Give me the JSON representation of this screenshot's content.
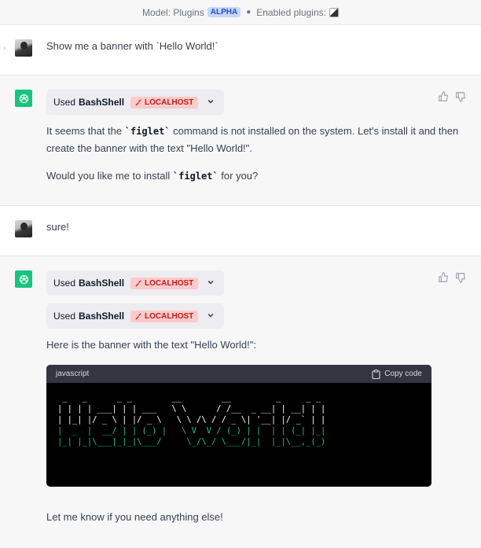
{
  "header": {
    "model_label": "Model: Plugins",
    "model_badge": "ALPHA",
    "plugins_label": "Enabled plugins:"
  },
  "messages": [
    {
      "role": "user",
      "text_pre": "Show me a banner with ",
      "text_code": "`Hello World!`"
    },
    {
      "role": "assistant",
      "plugin": {
        "used": "Used",
        "name": "BashShell",
        "badge": "LOCALHOST"
      },
      "para1_a": "It seems that the ",
      "para1_code": "`figlet`",
      "para1_b": " command is not installed on the system. Let's install it and then",
      "para1_c": "create the banner with the text \"Hello World!\".",
      "para2_a": "Would you like me to install ",
      "para2_code": "`figlet`",
      "para2_b": " for you?"
    },
    {
      "role": "user",
      "text": "sure!"
    },
    {
      "role": "assistant",
      "plugins": [
        {
          "used": "Used",
          "name": "BashShell",
          "badge": "LOCALHOST"
        },
        {
          "used": "Used",
          "name": "BashShell",
          "badge": "LOCALHOST"
        }
      ],
      "intro": "Here is the banner with the text \"Hello World!\":",
      "code_lang": "javascript",
      "copy_label": "Copy code",
      "code_lines": [
        " _   _      _ _        __        __         _     _ _ ",
        "| | | | ___| | | ___   \\ \\      / /__  _ __| | __| | |",
        "| |_| |/ _ \\ | |/ _ \\   \\ \\ /\\ / / _ \\| '__| |/ _` | |",
        "|  _  |  __/ | | (_) |   \\ V  V / (_) | |  | | (_| |_|",
        "|_| |_|\\___|_|_|\\___/     \\_/\\_/ \\___/|_|  |_|\\__,_(_)"
      ],
      "outro": "Let me know if you need anything else!"
    }
  ],
  "colors": {
    "bot_avatar": "#19c37d",
    "badge_bg": "#fecaca",
    "badge_text": "#b91c1c",
    "alpha_bg": "#c7d7fe"
  },
  "icons": [
    "openai-logo-icon",
    "wrench-icon",
    "chevron-down-icon",
    "thumbs-up-icon",
    "thumbs-down-icon",
    "clipboard-icon"
  ]
}
